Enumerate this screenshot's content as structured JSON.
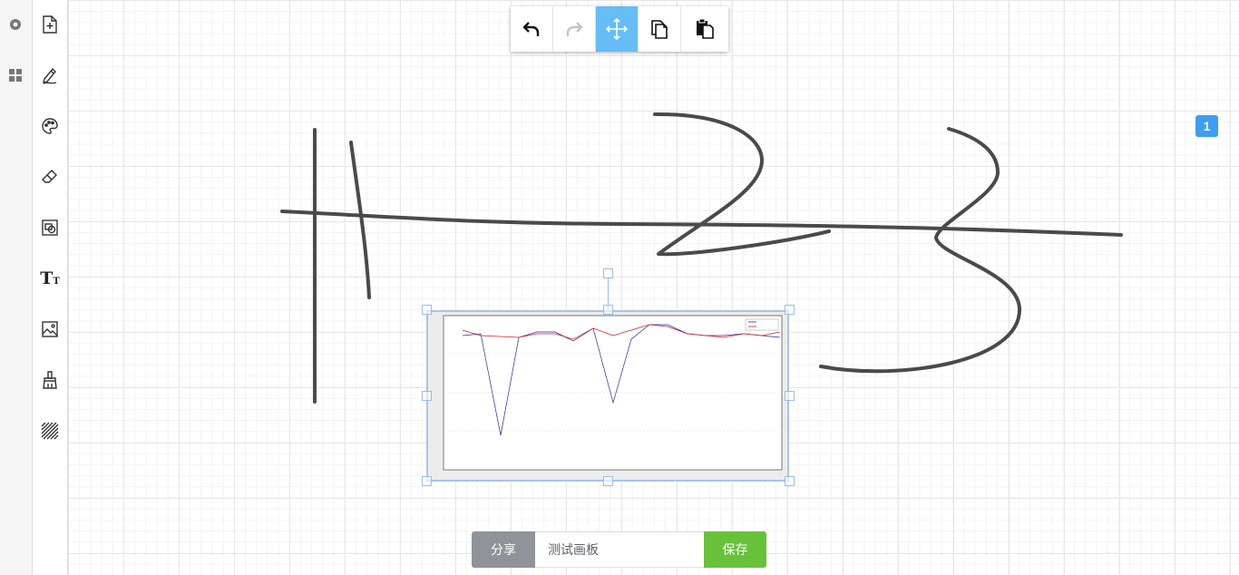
{
  "toolbar": {
    "tools": [
      "add-page",
      "pen",
      "palette",
      "eraser",
      "shape",
      "text",
      "image",
      "clear",
      "hatch"
    ],
    "text_tool_label": "T",
    "text_tool_sub": "T"
  },
  "topbar": {
    "buttons": [
      "undo",
      "redo",
      "move",
      "copy",
      "paste"
    ],
    "active": "move"
  },
  "page_badge": "1",
  "bottom": {
    "share_label": "分享",
    "board_name": "测试画板",
    "save_label": "保存"
  },
  "colors": {
    "accent": "#66bdf5",
    "badge": "#3d9df5",
    "share": "#909399",
    "save": "#67c23a",
    "stroke": "#4a4a4a"
  }
}
